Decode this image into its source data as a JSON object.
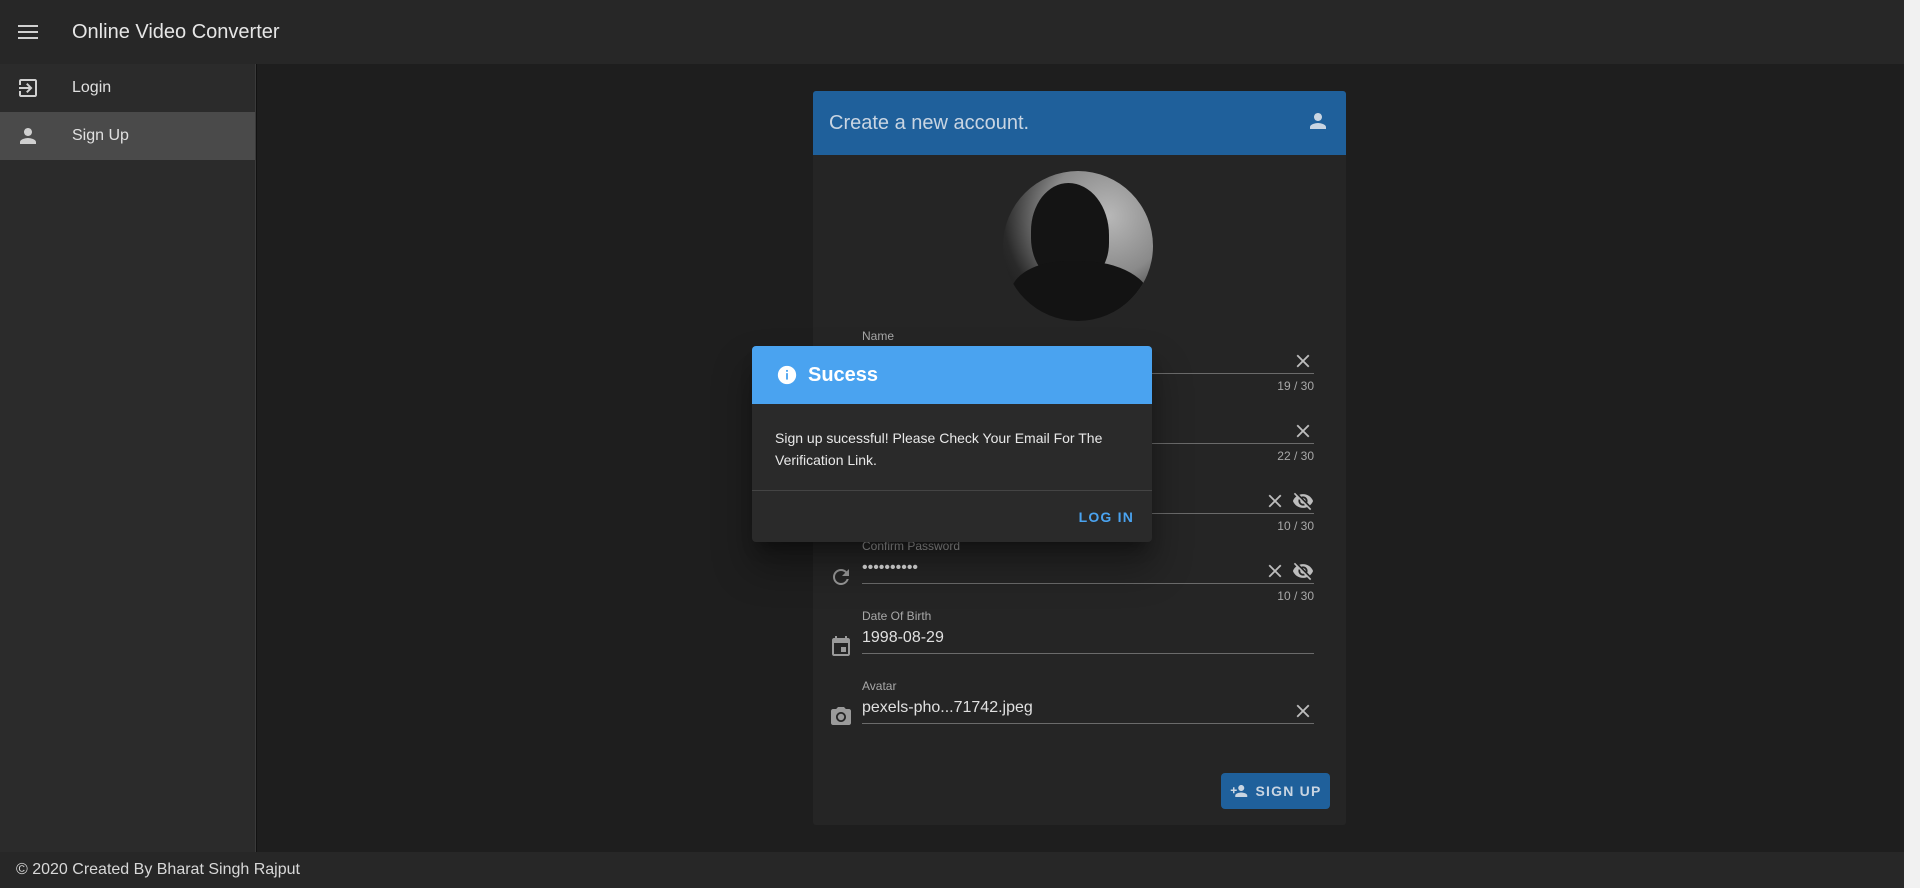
{
  "app": {
    "title": "Online Video Converter"
  },
  "sidebar": {
    "items": [
      {
        "label": "Login",
        "icon": "login-icon"
      },
      {
        "label": "Sign Up",
        "icon": "account-icon",
        "active": true
      }
    ]
  },
  "card": {
    "title": "Create a new account.",
    "fields": {
      "name": {
        "label": "Name",
        "value": "",
        "counter": "19 / 30"
      },
      "email": {
        "value": "",
        "counter": "22 / 30"
      },
      "password": {
        "value": "",
        "counter": "10 / 30"
      },
      "confirm_password": {
        "label": "Confirm Password",
        "value": "••••••••••",
        "counter": "10 / 30"
      },
      "dob": {
        "label": "Date Of Birth",
        "value": "1998-08-29"
      },
      "avatar": {
        "label": "Avatar",
        "value": "pexels-pho...71742.jpeg"
      }
    },
    "signup_label": "SIGN UP"
  },
  "dialog": {
    "title": "Sucess",
    "message": "Sign up sucessful! Please Check Your Email For The Verification Link.",
    "action_label": "LOG IN"
  },
  "footer": {
    "text": "© 2020 Created By Bharat Singh Rajput"
  },
  "colors": {
    "header": "#1f609b",
    "dialog_header": "#4aa3f0",
    "accent": "#4aa3f0"
  }
}
